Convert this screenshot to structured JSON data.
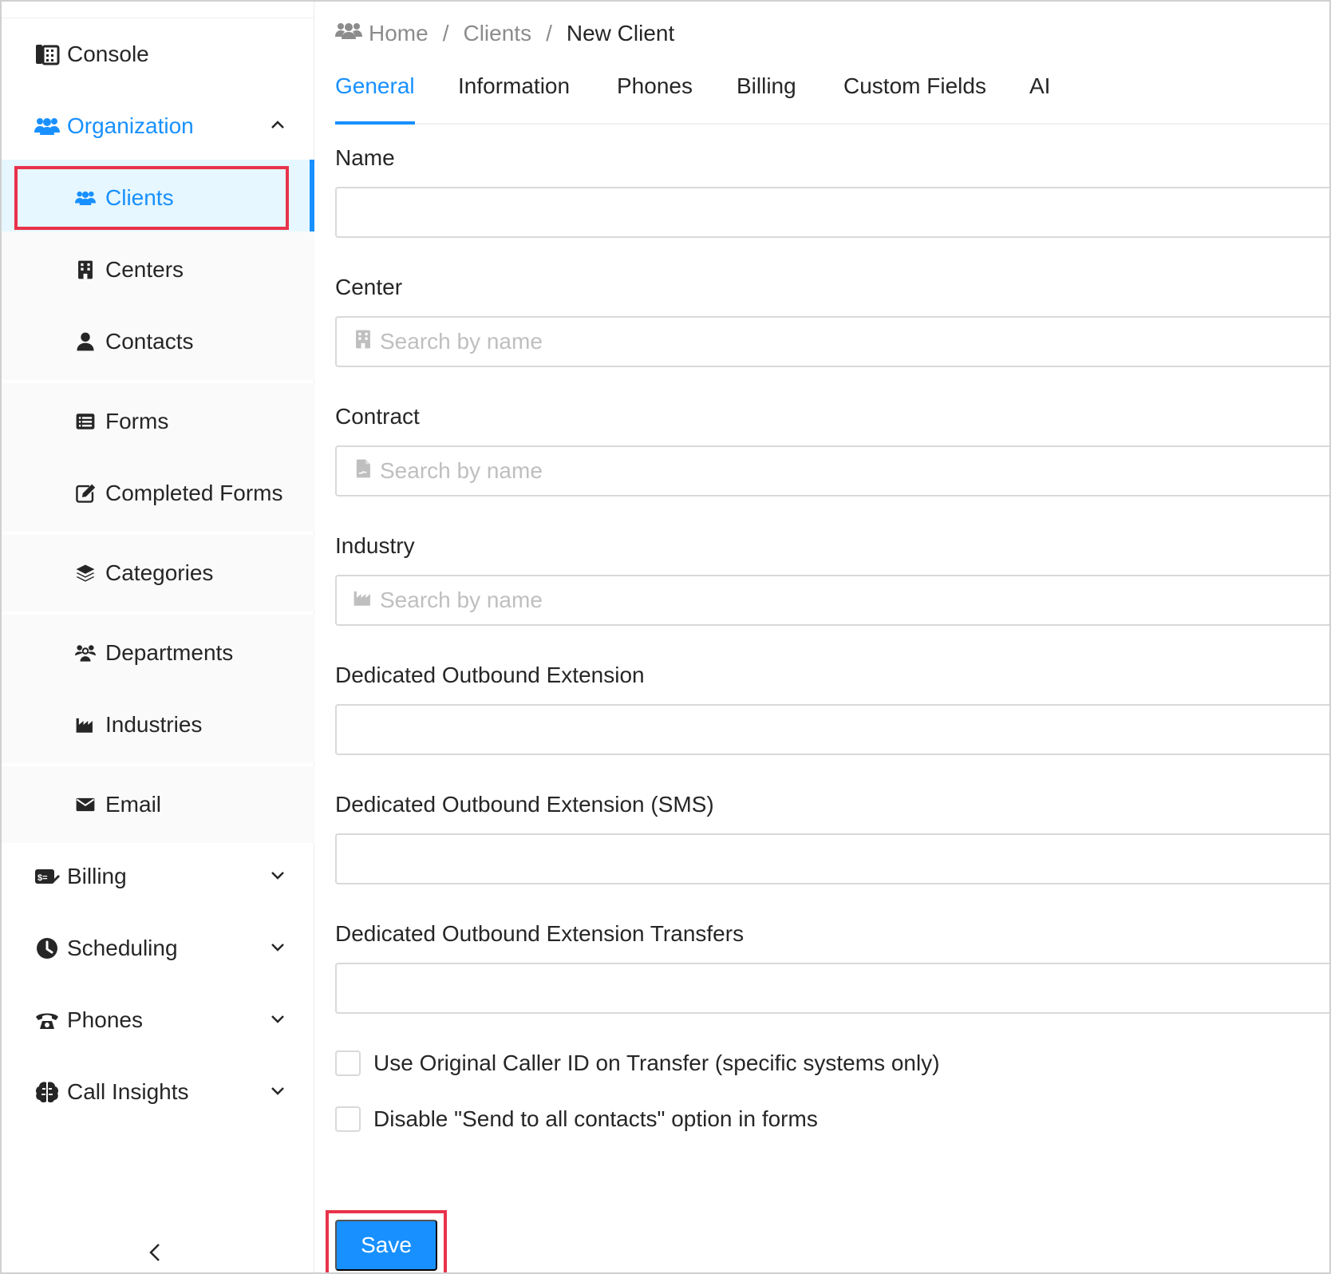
{
  "sidebar": {
    "items": [
      {
        "label": "Console",
        "icon": "console-icon"
      },
      {
        "label": "Organization",
        "icon": "users-icon",
        "expanded": true
      },
      {
        "label": "Billing",
        "icon": "billing-icon"
      },
      {
        "label": "Scheduling",
        "icon": "clock-icon"
      },
      {
        "label": "Phones",
        "icon": "phone-icon"
      },
      {
        "label": "Call Insights",
        "icon": "brain-icon"
      }
    ],
    "sub_items": [
      {
        "label": "Clients",
        "icon": "users-icon",
        "active": true
      },
      {
        "label": "Centers",
        "icon": "building-icon"
      },
      {
        "label": "Contacts",
        "icon": "user-icon"
      },
      {
        "label": "Forms",
        "icon": "list-icon"
      },
      {
        "label": "Completed Forms",
        "icon": "edit-icon"
      },
      {
        "label": "Categories",
        "icon": "layers-icon"
      },
      {
        "label": "Departments",
        "icon": "group-icon"
      },
      {
        "label": "Industries",
        "icon": "industry-icon"
      },
      {
        "label": "Email",
        "icon": "envelope-icon"
      }
    ],
    "collapse_icon": "chevron-left-icon"
  },
  "breadcrumb": {
    "home": "Home",
    "sep": "/",
    "clients": "Clients",
    "current": "New Client"
  },
  "tabs": [
    "General",
    "Information",
    "Phones",
    "Billing",
    "Custom Fields",
    "AI"
  ],
  "active_tab": "General",
  "form": {
    "name_label": "Name",
    "name_value": "",
    "center_label": "Center",
    "center_placeholder": "Search by name",
    "contract_label": "Contract",
    "contract_placeholder": "Search by name",
    "industry_label": "Industry",
    "industry_placeholder": "Search by name",
    "ext_label": "Dedicated Outbound Extension",
    "ext_sms_label": "Dedicated Outbound Extension (SMS)",
    "ext_transfers_label": "Dedicated Outbound Extension Transfers",
    "checkbox_caller_id": "Use Original Caller ID on Transfer (specific systems only)",
    "checkbox_send_all": "Disable \"Send to all contacts\" option in forms",
    "checkbox_caller_id_checked": false,
    "checkbox_send_all_checked": false
  },
  "save_label": "Save",
  "colors": {
    "accent": "#1890ff",
    "active_bg": "#e6f7ff",
    "highlight": "#e8334a"
  }
}
